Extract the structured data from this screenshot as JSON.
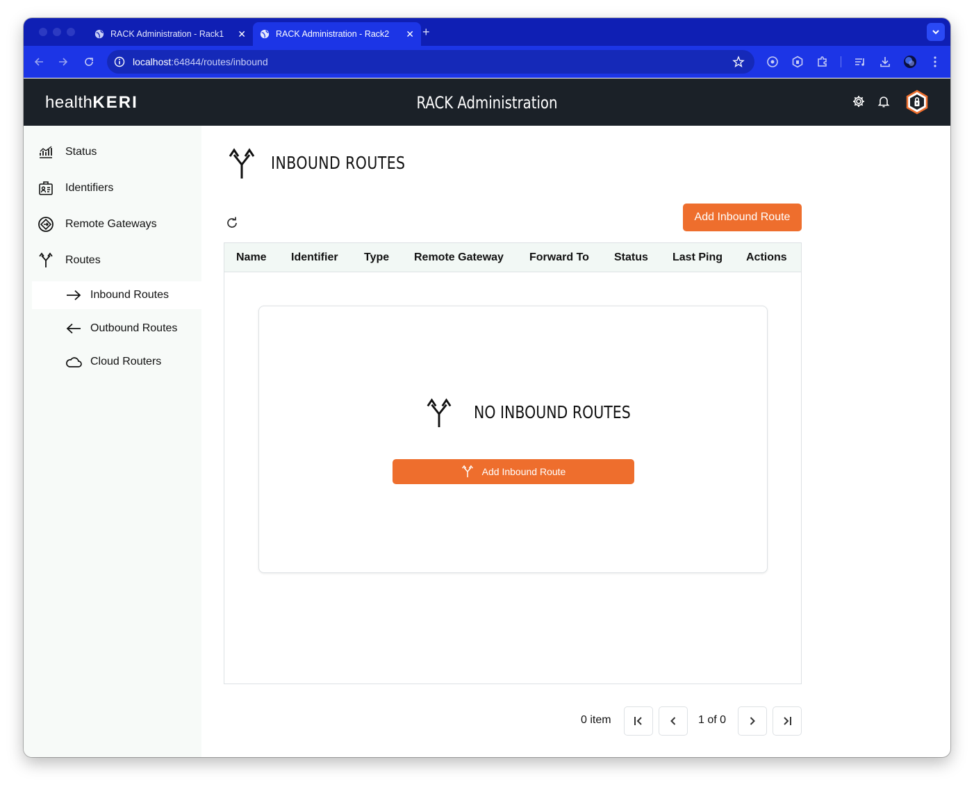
{
  "browser": {
    "tabs": [
      {
        "title": "RACK Administration - Rack1",
        "active": false
      },
      {
        "title": "RACK Administration - Rack2",
        "active": true
      }
    ],
    "url_host": "localhost",
    "url_rest": ":64844/routes/inbound"
  },
  "header": {
    "logo_part1": "health",
    "logo_part2": "KERI",
    "title": "RACK Administration"
  },
  "sidebar": {
    "items": [
      {
        "label": "Status",
        "icon": "chart-icon"
      },
      {
        "label": "Identifiers",
        "icon": "id-card-icon"
      },
      {
        "label": "Remote Gateways",
        "icon": "gateway-icon"
      },
      {
        "label": "Routes",
        "icon": "routes-icon"
      }
    ],
    "subitems": [
      {
        "label": "Inbound Routes",
        "icon": "arrow-right-icon",
        "active": true
      },
      {
        "label": "Outbound Routes",
        "icon": "arrow-left-icon",
        "active": false
      },
      {
        "label": "Cloud Routers",
        "icon": "cloud-icon",
        "active": false
      }
    ]
  },
  "main": {
    "page_title": "INBOUND ROUTES",
    "add_button": "Add Inbound Route",
    "columns": [
      "Name",
      "Identifier",
      "Type",
      "Remote Gateway",
      "Forward To",
      "Status",
      "Last Ping",
      "Actions"
    ],
    "empty_title": "NO INBOUND ROUTES",
    "empty_button": "Add Inbound Route"
  },
  "pagination": {
    "count": "0 item",
    "page": "1 of 0"
  },
  "colors": {
    "accent": "#ee6e2d",
    "header_bg": "#1b2128",
    "browser_blue": "#1c35e6"
  }
}
